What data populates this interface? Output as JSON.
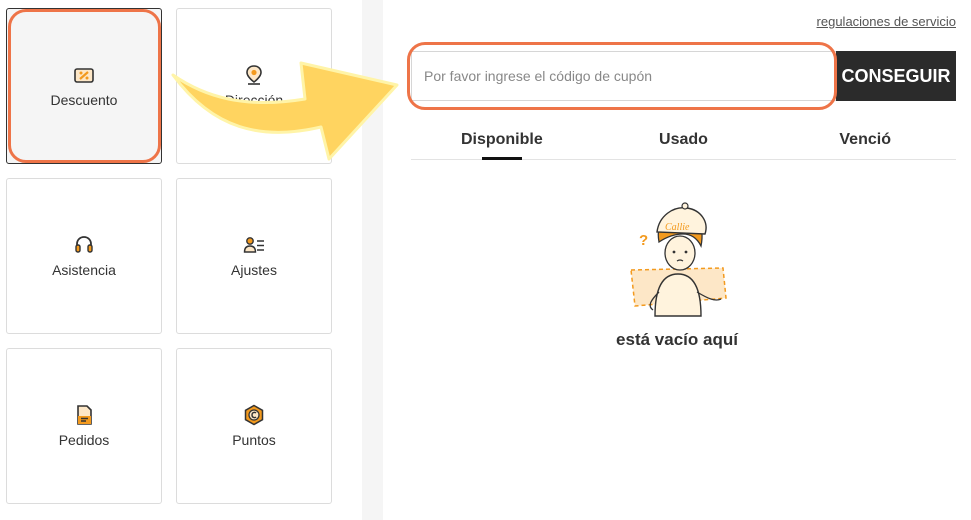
{
  "menu": {
    "items": [
      {
        "label": "Descuento",
        "icon": "coupon-icon",
        "active": true
      },
      {
        "label": "Dirección",
        "icon": "location-pin-icon"
      },
      {
        "label": "Asistencia",
        "icon": "headset-icon"
      },
      {
        "label": "Ajustes",
        "icon": "user-settings-icon"
      },
      {
        "label": "Pedidos",
        "icon": "orders-icon"
      },
      {
        "label": "Puntos",
        "icon": "points-coin-icon"
      }
    ]
  },
  "coupon": {
    "service_link": "regulaciones de servicio",
    "placeholder": "Por favor ingrese el código de cupón",
    "value": "",
    "button_label": "CONSEGUIR",
    "tabs": [
      {
        "label": "Disponible",
        "active": true
      },
      {
        "label": "Usado"
      },
      {
        "label": "Venció"
      }
    ],
    "empty_text": "está vacío aquí",
    "mascot_text": "Callie"
  },
  "colors": {
    "accent": "#ee7448",
    "icon_orange": "#f39a1e",
    "arrow_yellow": "#ffd460",
    "button_dark": "#2b2b2b"
  }
}
